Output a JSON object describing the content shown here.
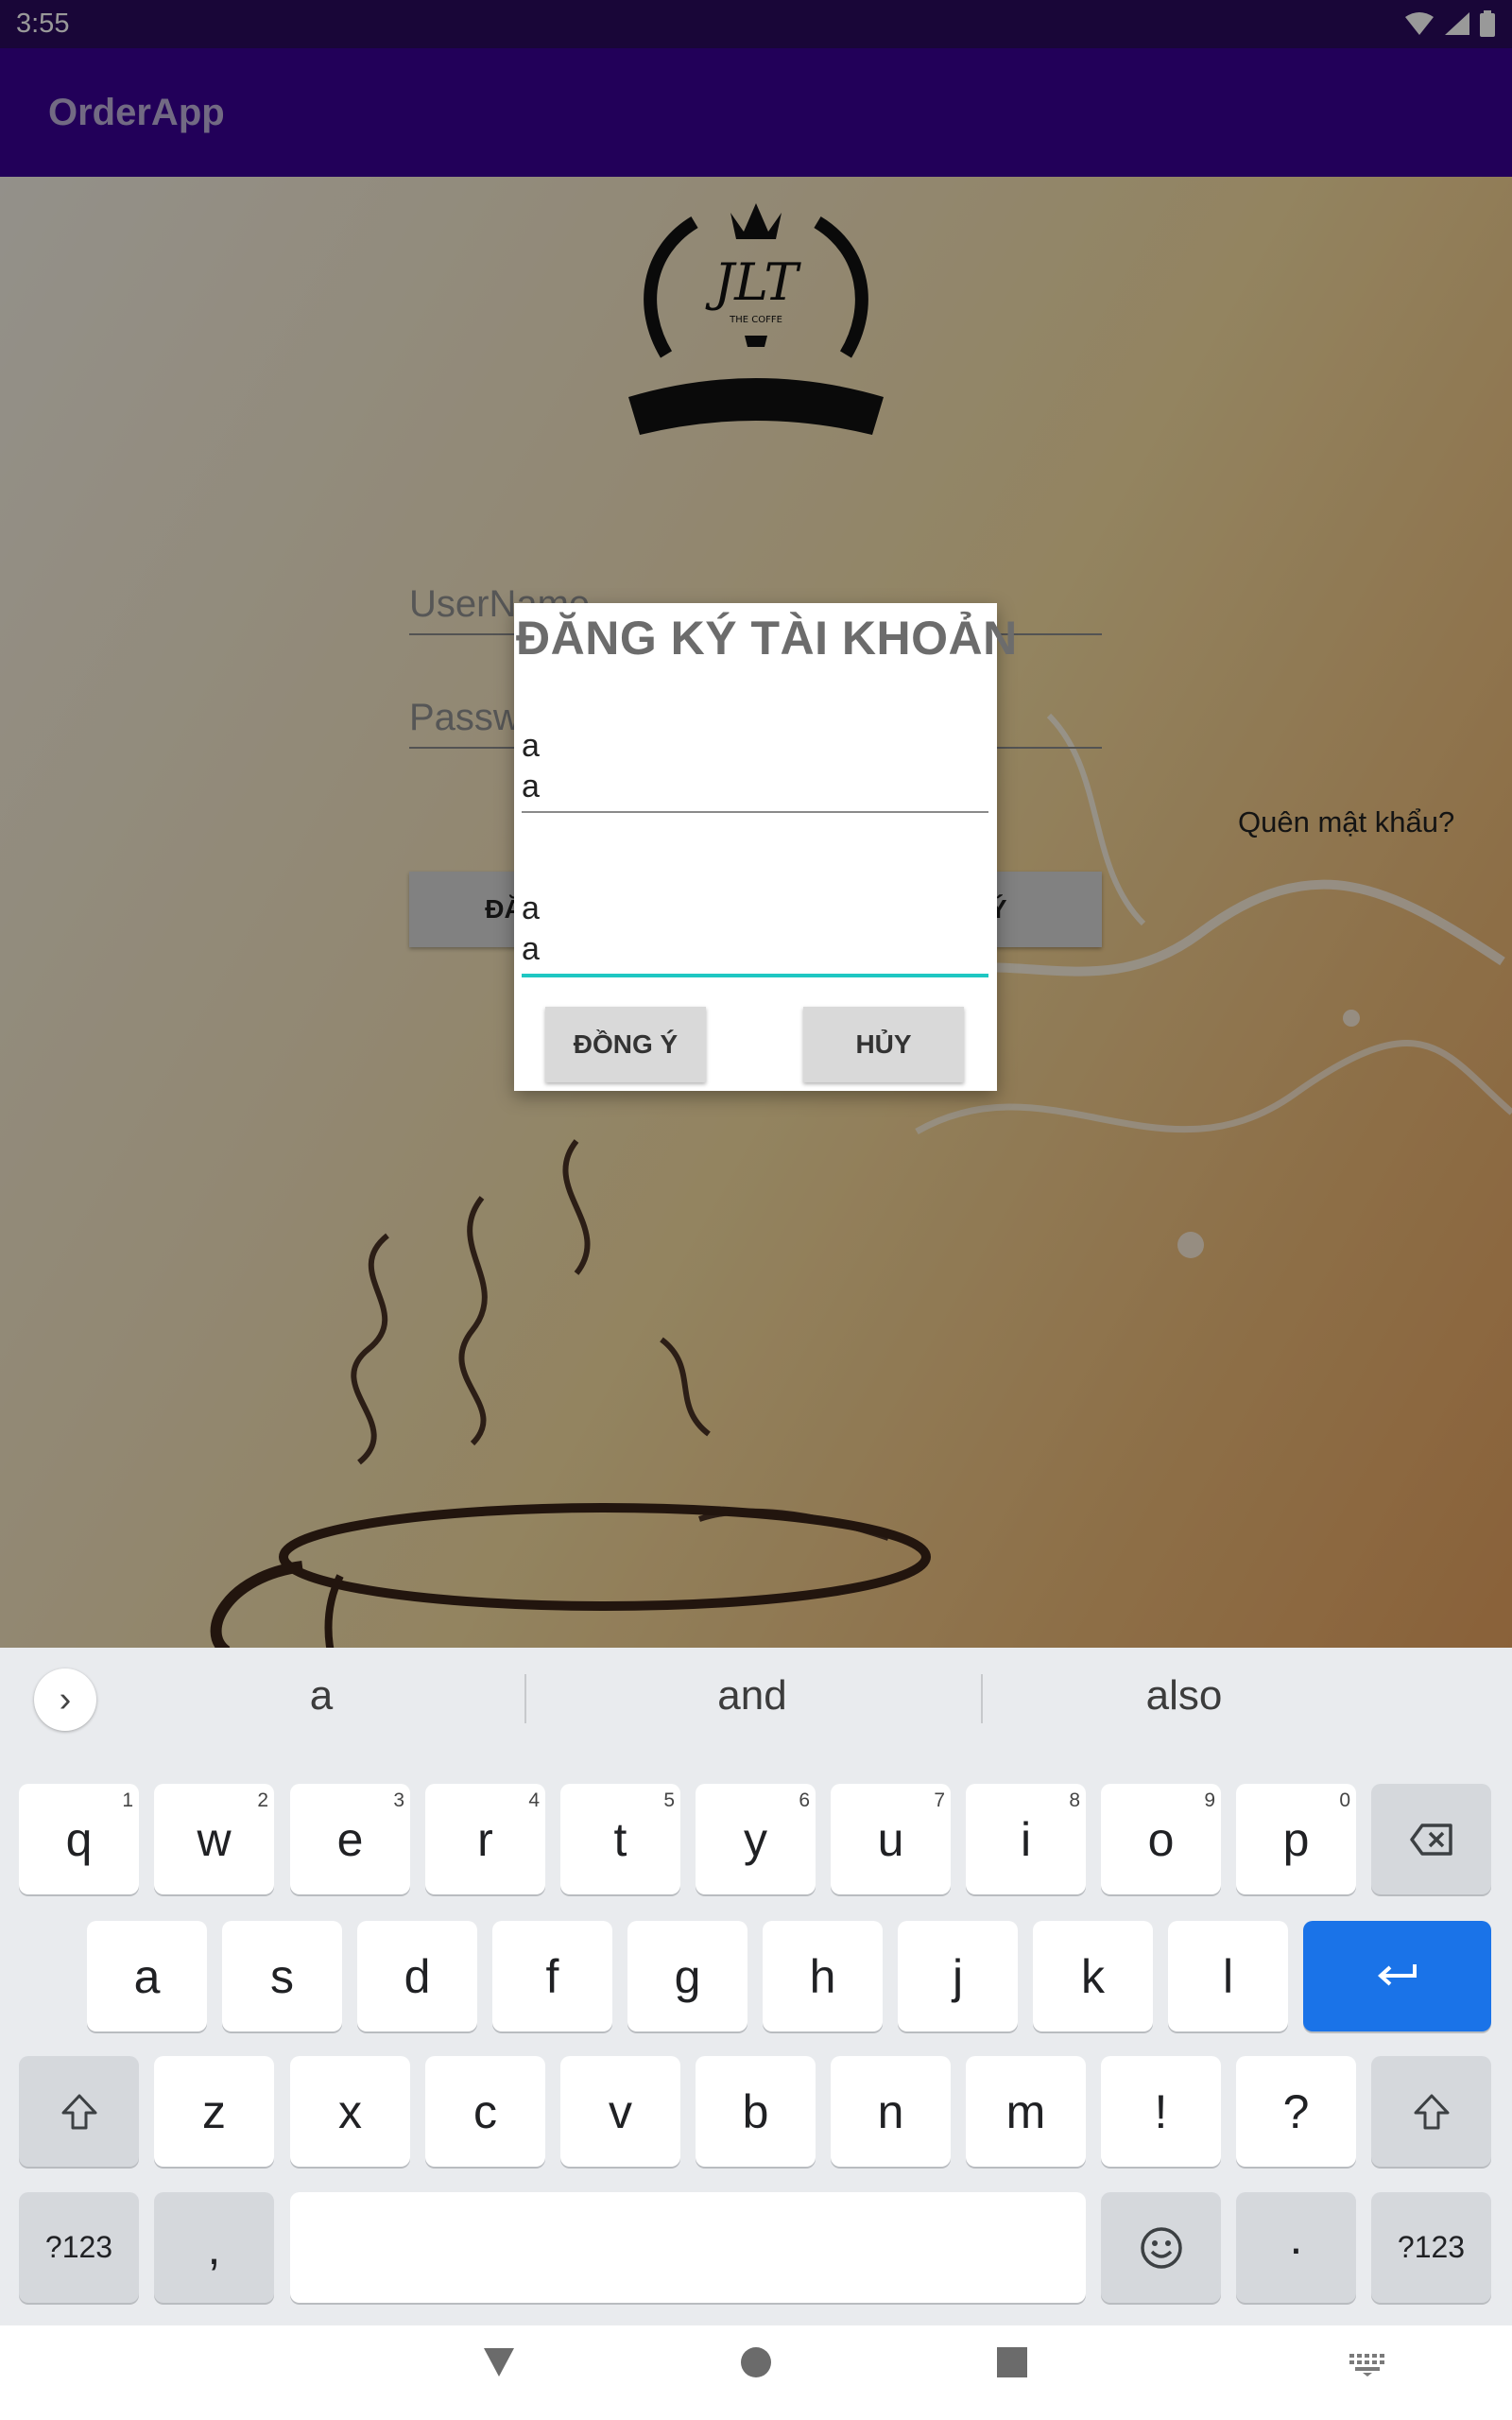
{
  "status_bar": {
    "time": "3:55"
  },
  "app_bar": {
    "title": "OrderApp"
  },
  "login_form": {
    "username_placeholder": "UserName",
    "password_placeholder": "Password",
    "forgot_password": "Quên mật khẩu?",
    "login_button": "ĐĂNG NHẬP",
    "register_button": "ĐĂNG KÝ"
  },
  "dialog": {
    "title": "ĐĂNG KÝ TÀI KHOẢN",
    "field1_lines": [
      "a",
      "a"
    ],
    "field2_lines": [
      "a",
      "a"
    ],
    "ok_button": "ĐỒNG Ý",
    "cancel_button": "HỦY"
  },
  "keyboard": {
    "suggestions": [
      "a",
      "and",
      "also"
    ],
    "row1": [
      {
        "label": "q",
        "hint": "1"
      },
      {
        "label": "w",
        "hint": "2"
      },
      {
        "label": "e",
        "hint": "3"
      },
      {
        "label": "r",
        "hint": "4"
      },
      {
        "label": "t",
        "hint": "5"
      },
      {
        "label": "y",
        "hint": "6"
      },
      {
        "label": "u",
        "hint": "7"
      },
      {
        "label": "i",
        "hint": "8"
      },
      {
        "label": "o",
        "hint": "9"
      },
      {
        "label": "p",
        "hint": "0"
      }
    ],
    "row2": [
      "a",
      "s",
      "d",
      "f",
      "g",
      "h",
      "j",
      "k",
      "l"
    ],
    "row3": [
      "z",
      "x",
      "c",
      "v",
      "b",
      "n",
      "m",
      "!",
      "?"
    ],
    "symbols_key": "?123",
    "comma_key": ",",
    "period_key": "·",
    "icons": {
      "backspace": "backspace-icon",
      "enter": "enter-icon",
      "shift": "shift-icon",
      "emoji": "emoji-icon",
      "suggestions_toggle": "chevron-right-icon"
    },
    "accent_color": "#1a73e8"
  },
  "colors": {
    "status_bar": "#2a0a5e",
    "app_bar": "#3a0095",
    "field_focus": "#1fc7c2"
  }
}
